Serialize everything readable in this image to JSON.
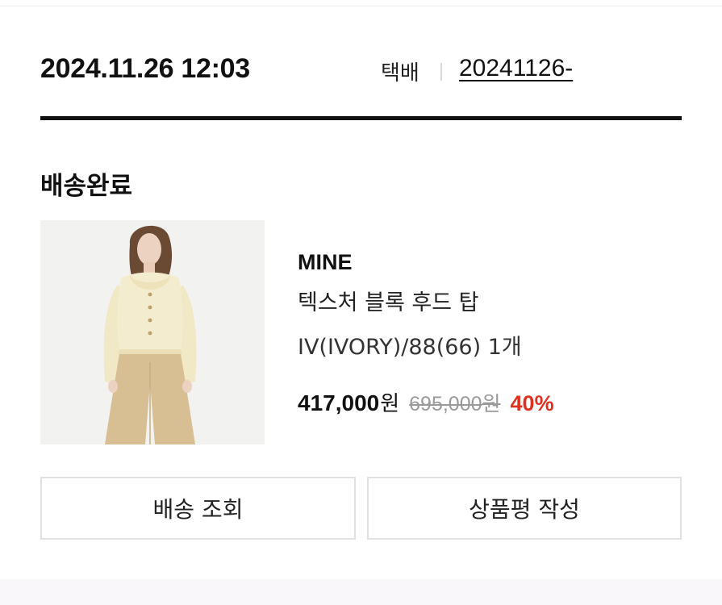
{
  "order": {
    "datetime": "2024.11.26 12:03",
    "carrier": "택배",
    "tracking_number": "20241126-"
  },
  "status": "배송완료",
  "product": {
    "brand": "MINE",
    "name": "텍스처 블록 후드 탑",
    "option": "IV(IVORY)/88(66) 1개",
    "sale_price": "417,000",
    "sale_price_unit": "원",
    "original_price": "695,000",
    "original_price_unit": "원",
    "discount": "40%"
  },
  "buttons": {
    "track": "배송 조회",
    "review": "상품평 작성"
  },
  "colors": {
    "discount": "#e0301e",
    "text": "#111111",
    "strike": "#9a9a9a",
    "border": "#e1e1e1"
  }
}
